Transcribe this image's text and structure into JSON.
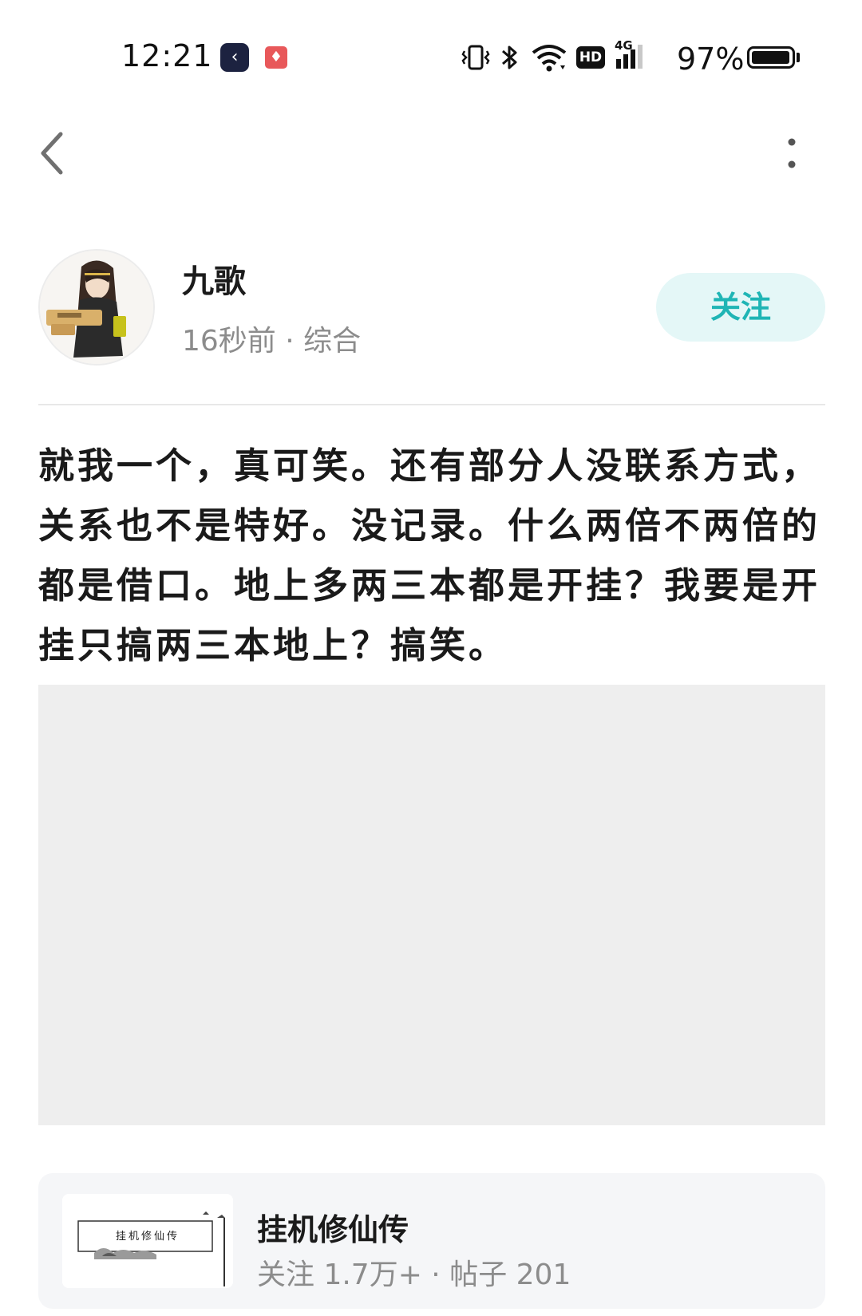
{
  "status_bar": {
    "time": "12:21",
    "battery": "97%",
    "battery_level": 0.97,
    "icons": [
      "app-icon",
      "notification-app-icon",
      "vibrate-icon",
      "bluetooth-icon",
      "wifi-icon",
      "hd-icon",
      "signal-4g-icon",
      "battery-icon"
    ],
    "signal_badge": "4G",
    "hd_label": "HD"
  },
  "nav": {
    "back_icon": "chevron-left-icon",
    "more_icon": "more-vertical-icon"
  },
  "author": {
    "name": "九歌",
    "meta": "16秒前 · 综合",
    "follow_label": "关注"
  },
  "post": {
    "body": "就我一个，真可笑。还有部分人没联系方式，关系也不是特好。没记录。什么两倍不两倍的都是借口。地上多两三本都是开挂？我要是开挂只搞两三本地上？搞笑。"
  },
  "forum": {
    "name": "挂机修仙传",
    "stats": "关注 1.7万+ · 帖子 201",
    "thumb_text": "挂机修仙传"
  },
  "colors": {
    "accent": "#1fb5b5",
    "follow_bg": "#e4f7f7",
    "meta_text": "#8c8c8c",
    "card_bg": "#f5f6f8",
    "placeholder": "#eeeeee"
  }
}
